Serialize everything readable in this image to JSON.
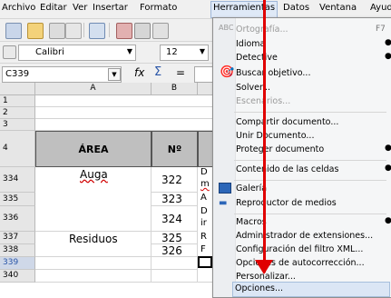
{
  "menubar": {
    "items": [
      "Archivo",
      "Editar",
      "Ver",
      "Insertar",
      "Formato",
      "Herramientas",
      "Datos",
      "Ventana",
      "Ayuda"
    ]
  },
  "toolbar": {
    "font_name": "Calibri",
    "font_size": "12",
    "cell_ref": "C339",
    "fx": "fx",
    "sum": "Σ",
    "equals": "="
  },
  "sheet": {
    "columns": [
      "A",
      "B"
    ],
    "rows": [
      "1",
      "2",
      "3",
      "4",
      "334",
      "335",
      "336",
      "337",
      "338",
      "339",
      "340"
    ],
    "header_area": "ÁREA",
    "header_no": "Nº",
    "cells": {
      "auga": "Auga",
      "residuos": "Residuos",
      "n322": "322",
      "n323": "323",
      "n324": "324",
      "n325": "325",
      "n326": "326"
    },
    "c_fragments": [
      "D",
      "m",
      "A",
      "D",
      "ir",
      "R",
      "F"
    ]
  },
  "menu": {
    "items": [
      {
        "label": "Ortografía...",
        "shortcut": "F7",
        "disabled": true,
        "icon": "spellcheck-icon"
      },
      {
        "label": "Idioma",
        "sub": true
      },
      {
        "label": "Detective",
        "sub": true
      },
      {
        "label": "Buscar objetivo...",
        "icon": "goal-seek-icon"
      },
      {
        "label": "Solver..."
      },
      {
        "label": "Escenarios...",
        "disabled": true
      },
      {
        "label": "Compartir documento..."
      },
      {
        "label": "Unir Documento..."
      },
      {
        "label": "Proteger documento",
        "sub": true
      },
      {
        "label": "Contenido de las celdas",
        "sub": true
      },
      {
        "label": "Galería",
        "icon": "gallery-icon"
      },
      {
        "label": "Reproductor de medios",
        "icon": "media-player-icon"
      },
      {
        "label": "Macros",
        "sub": true
      },
      {
        "label": "Administrador de extensiones..."
      },
      {
        "label": "Configuración del filtro XML..."
      },
      {
        "label": "Opciones de autocorrección..."
      },
      {
        "label": "Personalizar..."
      },
      {
        "label": "Opciones..."
      }
    ]
  },
  "colors": {
    "annotation": "#e00000",
    "menu_highlight": "#dbe6f5",
    "header_fill": "#bfbfbf"
  }
}
